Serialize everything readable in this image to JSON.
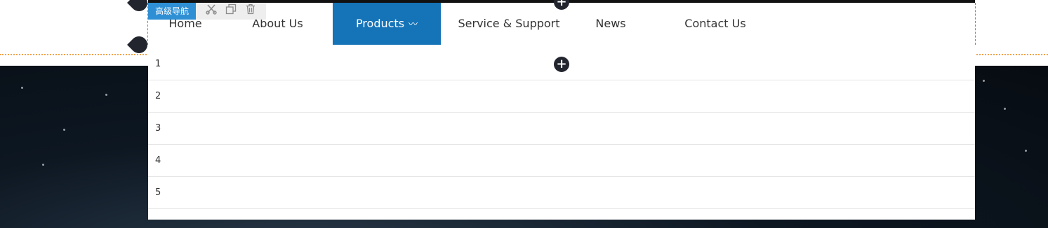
{
  "editor_tag": {
    "label": "高级导航",
    "tools": [
      "scissors-icon",
      "copy-icon",
      "trash-icon"
    ]
  },
  "nav": {
    "items": [
      {
        "label": "Home"
      },
      {
        "label": "About Us"
      },
      {
        "label": "Products",
        "active": true,
        "suffix": "〰"
      },
      {
        "label": "Service & Support"
      },
      {
        "label": "News"
      },
      {
        "label": "Contact Us"
      }
    ]
  },
  "dropdown": {
    "rows": [
      "1",
      "2",
      "3",
      "4",
      "5"
    ]
  },
  "controls": {
    "add_symbol": "+"
  },
  "colors": {
    "accent": "#1573b8",
    "tag": "#2e8fd5",
    "dark": "#22252e"
  }
}
